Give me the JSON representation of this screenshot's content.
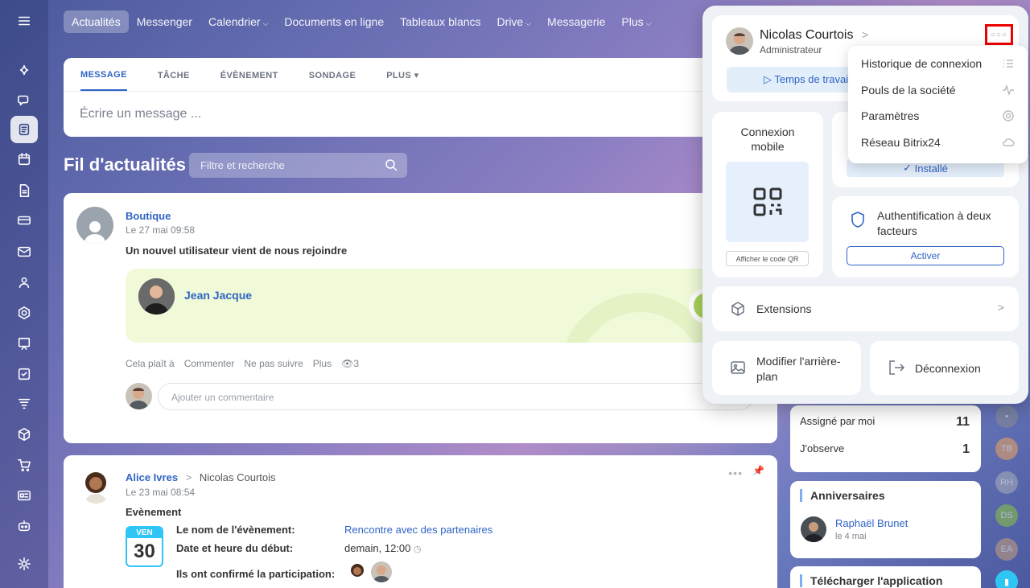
{
  "nav": {
    "items": [
      "Actualités",
      "Messenger",
      "Calendrier",
      "Documents en ligne",
      "Tableaux blancs",
      "Drive",
      "Messagerie",
      "Plus"
    ]
  },
  "composer": {
    "tabs": [
      "MESSAGE",
      "TÂCHE",
      "ÉVÈNEMENT",
      "SONDAGE",
      "PLUS"
    ],
    "placeholder": "Écrire un message ..."
  },
  "feed": {
    "title": "Fil d'actualités",
    "search_placeholder": "Filtre et recherche"
  },
  "post1": {
    "author": "Boutique",
    "date": "Le 27 mai 09:58",
    "title": "Un nouvel utilisateur vient de nous rejoindre",
    "new_user": "Jean Jacque",
    "actions": [
      "Cela plaît à",
      "Commenter",
      "Ne pas suivre",
      "Plus"
    ],
    "views": "3",
    "comment_placeholder": "Ajouter un commentaire"
  },
  "post2": {
    "author": "Alice Ivres",
    "recipient": "Nicolas Courtois",
    "date": "Le 23 mai 08:54",
    "type_label": "Evènement",
    "cal_day": "VEN",
    "cal_num": "30",
    "rows": [
      {
        "label": "Le nom de l'évènement:",
        "value": "Rencontre avec des partenaires"
      },
      {
        "label": "Date et heure du début:",
        "value": "demain, 12:00"
      },
      {
        "label": "Ils ont confirmé la participation:",
        "value": ""
      }
    ]
  },
  "tasks_widget": {
    "rows": [
      {
        "label": "Assigné par moi",
        "count": "11"
      },
      {
        "label": "J'observe",
        "count": "1"
      }
    ]
  },
  "birthdays": {
    "title": "Anniversaires",
    "person": "Raphaël Brunet",
    "date": "le 4 mai"
  },
  "app_widget": {
    "title": "Télécharger l'application"
  },
  "side_avatars": [
    "TB",
    "RH",
    "DS",
    "EA"
  ],
  "profile": {
    "name": "Nicolas Courtois",
    "role": "Administrateur",
    "time_button": "Temps de travail",
    "mobile_title": "Connexion mobile",
    "qr_button": "Afficher le code QR",
    "installed": "Installé",
    "twofa_title": "Authentification à deux facteurs",
    "twofa_button": "Activer",
    "extensions": "Extensions",
    "background": "Modifier l'arrière-plan",
    "logout": "Déconnexion"
  },
  "more_menu": {
    "items": [
      {
        "label": "Historique de connexion",
        "icon": "list-icon"
      },
      {
        "label": "Pouls de la société",
        "icon": "pulse-icon"
      },
      {
        "label": "Paramètres",
        "icon": "gear-icon"
      },
      {
        "label": "Réseau Bitrix24",
        "icon": "cloud-icon"
      }
    ]
  },
  "colors": {
    "accent": "#2f64c4",
    "highlight_border": "#e00000"
  }
}
